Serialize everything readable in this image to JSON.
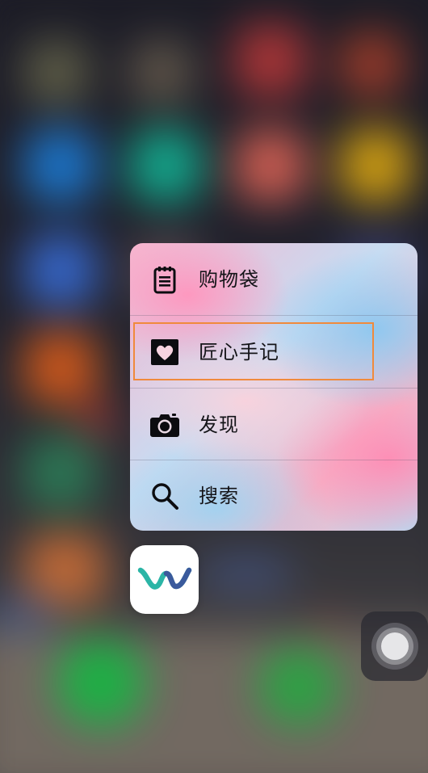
{
  "menu": {
    "items": [
      {
        "label": "购物袋",
        "icon": "shopping-list-icon"
      },
      {
        "label": "匠心手记",
        "icon": "heart-icon"
      },
      {
        "label": "发现",
        "icon": "camera-icon"
      },
      {
        "label": "搜索",
        "icon": "search-icon"
      }
    ],
    "highlighted_index": 1,
    "highlight_color": "#f08a3c"
  },
  "app": {
    "icon": "app-logo-icon",
    "logo_colors": [
      "#2bb5a6",
      "#3a5a9c"
    ]
  },
  "assistive_touch": {
    "icon": "assistive-touch-button"
  }
}
